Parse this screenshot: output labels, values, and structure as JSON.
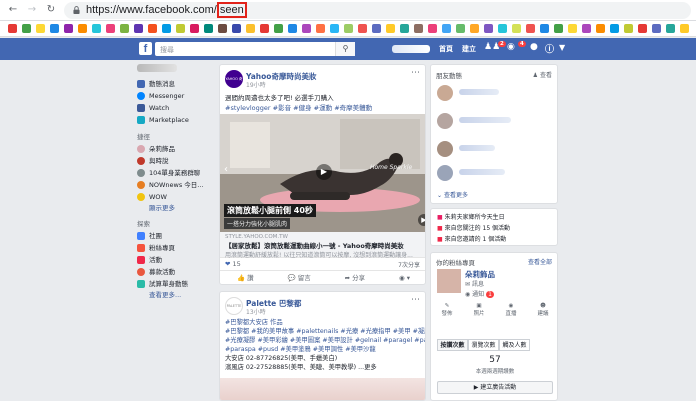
{
  "browser": {
    "url_prefix": "https://www.facebook.com/",
    "url_highlight": "seen",
    "back_icon": "arrow-left-icon",
    "forward_icon": "arrow-right-icon",
    "reload_icon": "reload-icon"
  },
  "fb": {
    "logo": "f",
    "search_placeholder": "搜尋",
    "nav_home": "首頁",
    "nav_create": "建立",
    "badge_friends": "2",
    "badge_messages": "4",
    "brand_color": "#4267b2"
  },
  "left_nav": {
    "items": [
      "動態消息",
      "Messenger",
      "Watch",
      "Marketplace"
    ],
    "shortcuts_header": "捷徑",
    "shortcuts": [
      "朵莉飾品",
      "與時說",
      "104單身業務群聊",
      "NOWnews 今日...",
      "WOW"
    ],
    "shortcuts_more": "顯示更多",
    "explore_header": "探索",
    "explore": [
      "社團",
      "粉絲專頁",
      "活動",
      "募款活動",
      "試算單身動態"
    ],
    "explore_more": "查看更多..."
  },
  "post1": {
    "page": "Yahoo奇摩時尚美妝",
    "avatar_text": "YAHOO 奇摩",
    "time": "19小時",
    "text": "週間約周邁也太多了吧! 必選手刀購入",
    "tags": "#stylevlogger #影音 #健身 #運動 #奇摩美體動",
    "video_caption": "滾筒放鬆小腿前側 40秒",
    "video_subcaption": "一搭分力強化小腿肌肉",
    "watermark": "Home Sparkle",
    "domain": "STYLE.YAHOO.COM.TW",
    "headline": "【居家放鬆】滾筒放鬆運動曲線小一號 - Yahoo奇摩時尚美妝",
    "desc": "用滾筒運動舒緩放鬆! 以往只知道滾筒可以按摩, 沒想到滾筒運動讓身...",
    "reactions": "15",
    "shares": "7次分享",
    "like": "讚",
    "comment": "留言",
    "share": "分享"
  },
  "post2": {
    "page": "Palette 巴黎都",
    "avatar_text": "PALETTE",
    "time": "13小時",
    "line1": "#巴黎都大安店 作品",
    "line2": "#巴黎都 #我的美甲故事 #palettenails #光療 #光療指甲 #美甲 #凝膠指甲",
    "line3": "#光療凝膠 #美甲彩繪 #美甲圖案 #美甲設計 #gelnail #paragel #parapolish",
    "line4": "#paraspa #pusd #美甲塗鴉 #美甲調性 #美甲沙龍",
    "addr1": "大安店 02-87726825(美甲、手蠟美白)",
    "addr2": "濱風店 02-27528885(美甲、美睫、美甲教學) ...更多"
  },
  "right": {
    "activity_title": "朋友動態",
    "activity_action": "查看",
    "activity_more": "查看更多",
    "event1": "朱莉夫家鄉所今天生日",
    "event2": "來自您關注的 15 個活動",
    "event3": "來自您邀請的 1 個活動",
    "pages_title": "你的粉絲專頁",
    "pages_more": "查看全部",
    "page_name": "朵莉飾品",
    "page_msg": "訊息",
    "page_notify": "通知",
    "page_notify_count": "1",
    "actions": [
      "發佈",
      "照片",
      "直播",
      "建議"
    ],
    "tabs": [
      "按讚次數",
      "瀏覽次數",
      "觸及人數"
    ],
    "likes_count": "57",
    "likes_label": "本週兩週期讚數",
    "promote": "建立廣告活動"
  }
}
